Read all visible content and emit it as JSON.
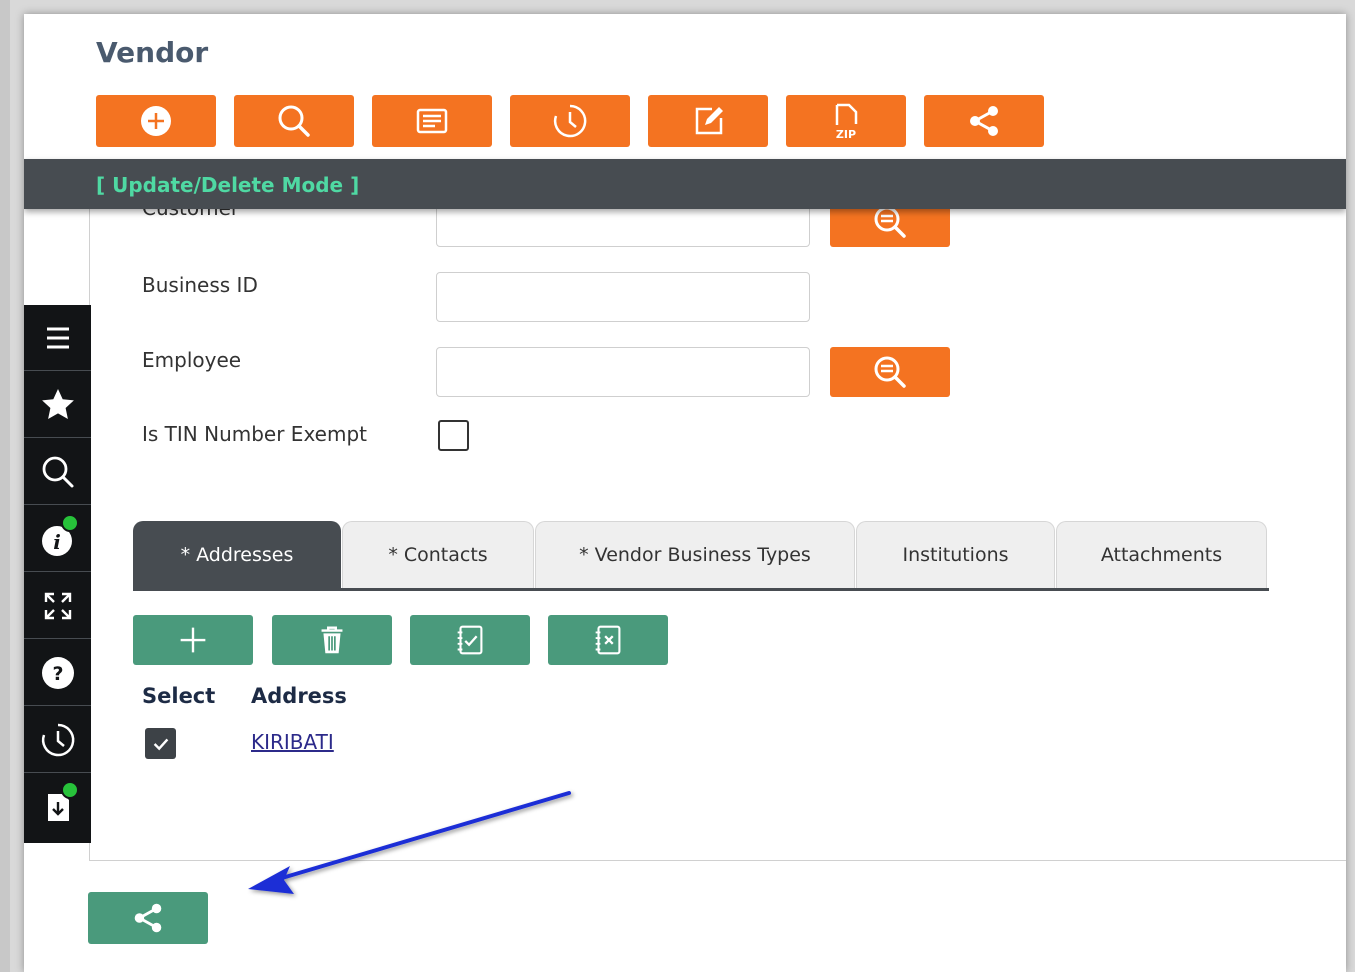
{
  "page": {
    "title": "Vendor"
  },
  "toolbar": {
    "buttons": [
      {
        "name": "add-button",
        "icon": "plus-circle-icon"
      },
      {
        "name": "search-button",
        "icon": "search-icon"
      },
      {
        "name": "list-button",
        "icon": "list-icon"
      },
      {
        "name": "history-button",
        "icon": "clock-icon"
      },
      {
        "name": "edit-button",
        "icon": "edit-icon"
      },
      {
        "name": "zip-button",
        "icon": "zip-file-icon",
        "label": "ZIP"
      },
      {
        "name": "share-button",
        "icon": "share-icon"
      }
    ]
  },
  "mode_bar": {
    "text": "[ Update/Delete Mode ]"
  },
  "form": {
    "customer_label": "Customer",
    "business_id_label": "Business ID",
    "employee_label": "Employee",
    "tin_exempt_label": "Is TIN Number Exempt",
    "tin_exempt_checked": false
  },
  "tabs": [
    {
      "label": "* Addresses",
      "active": true
    },
    {
      "label": "* Contacts",
      "active": false
    },
    {
      "label": "* Vendor Business Types",
      "active": false
    },
    {
      "label": "Institutions",
      "active": false
    },
    {
      "label": "Attachments",
      "active": false
    }
  ],
  "grid": {
    "columns": {
      "select": "Select",
      "address": "Address"
    },
    "rows": [
      {
        "selected": true,
        "address": "KIRIBATI"
      }
    ]
  },
  "sidebar": {
    "items": [
      "menu-icon",
      "star-icon",
      "search-icon",
      "info-icon",
      "expand-icon",
      "help-icon",
      "history-icon",
      "download-icon"
    ]
  },
  "colors": {
    "orange": "#f47321",
    "green": "#4a9a7c",
    "dark": "#474c51",
    "mode_text": "#4fd9a3",
    "annotation_arrow": "#1f2fd6"
  }
}
